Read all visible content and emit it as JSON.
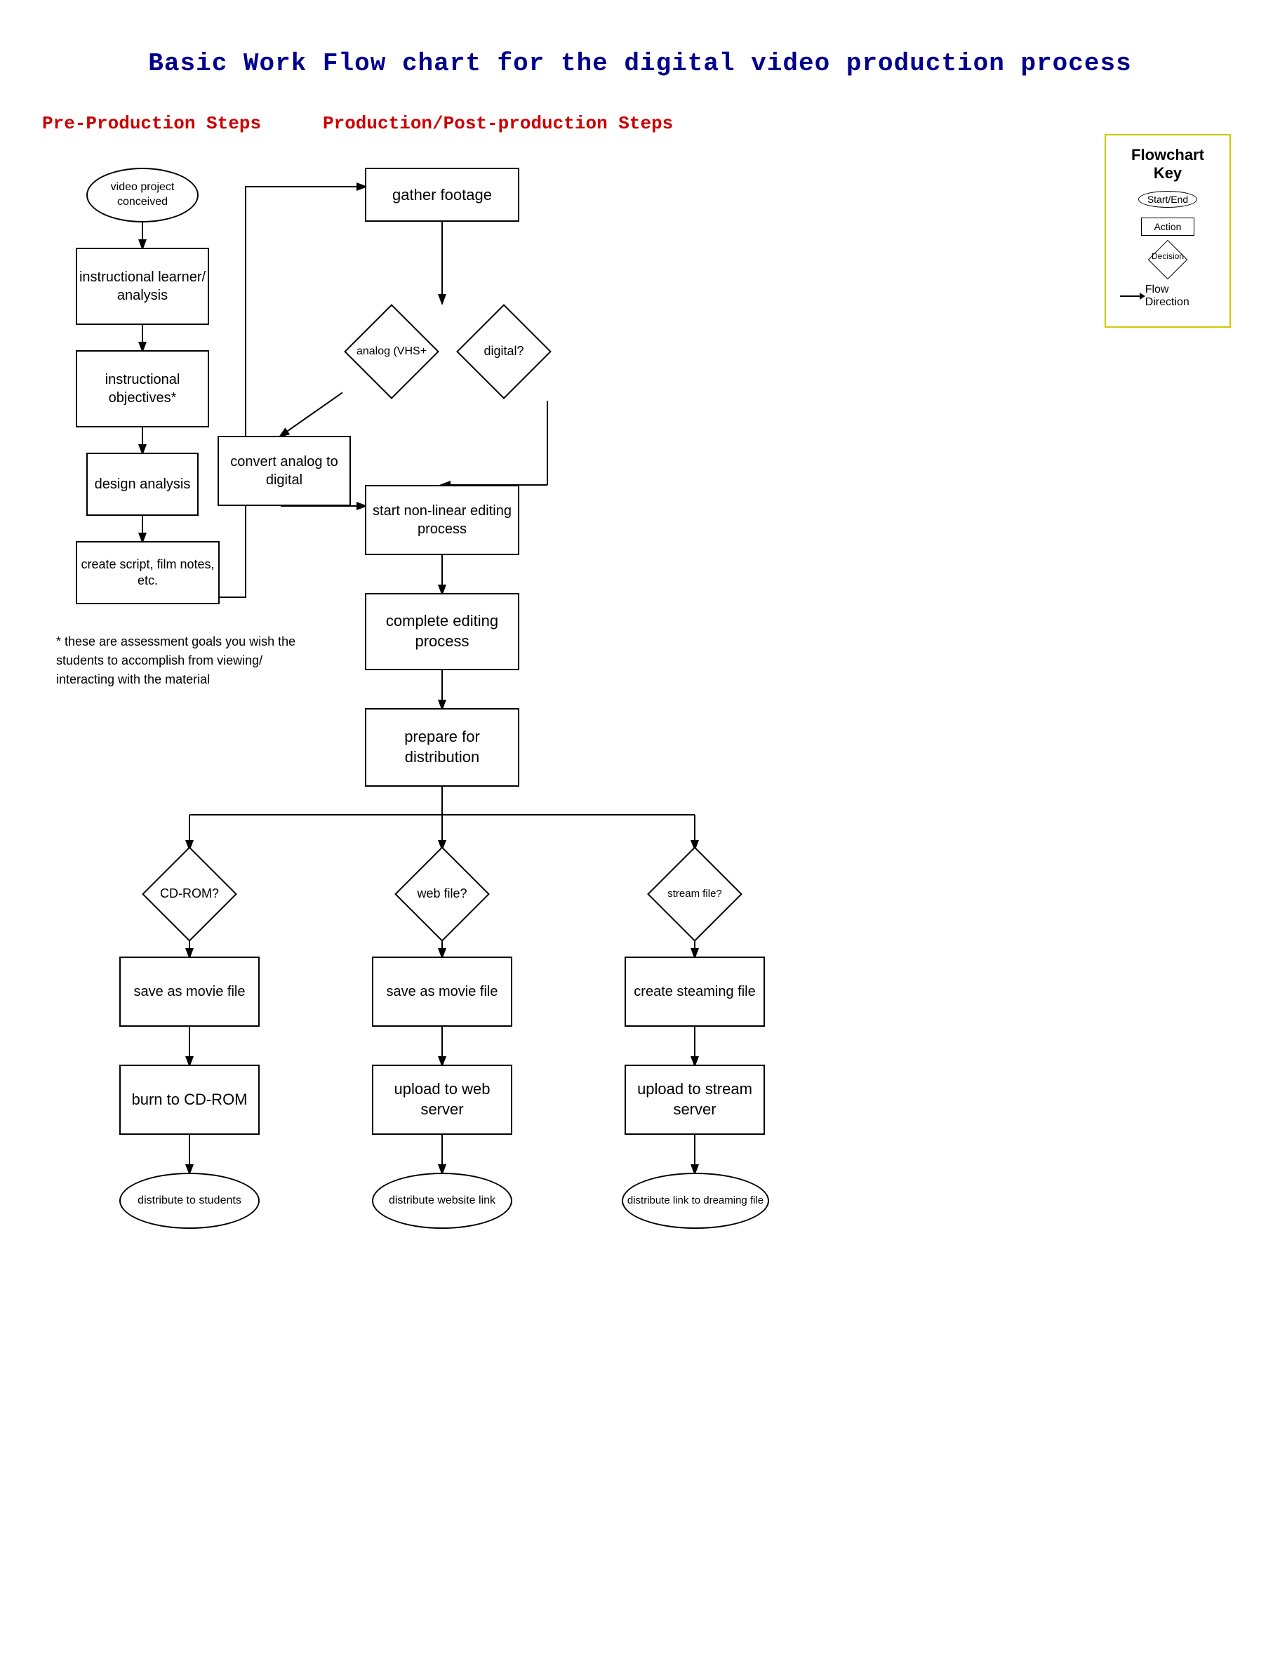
{
  "title": "Basic Work Flow chart for the digital video production process",
  "pre_production_label": "Pre-Production Steps",
  "production_label": "Production/Post-production Steps",
  "key": {
    "title": "Flowchart Key",
    "start_end_label": "Start/End",
    "action_label": "Action",
    "decision_label": "Decision",
    "flow_label": "Flow Direction"
  },
  "nodes": {
    "video_project_conceived": "video project\nconceived",
    "instructional_learner": "instructional\nlearner/ analysis",
    "instructional_objectives": "instructional\nobjectives*",
    "design_analysis": "design\nanalysis",
    "create_script": "create script,\nfilm notes, etc.",
    "gather_footage": "gather footage",
    "analog_vhs": "analog (VHS+",
    "digital": "digital?",
    "convert_analog": "convert analog\nto digital",
    "start_nonlinear": "start non-linear\nediting process",
    "complete_editing": "complete\nediting process",
    "prepare_distribution": "prepare for\ndistribution",
    "cdrom_decision": "CD-ROM?",
    "web_decision": "web file?",
    "stream_decision": "stream\nfile?",
    "save_movie_cdrom": "save as movie\nfile",
    "save_movie_web": "save as movie\nfile",
    "create_streaming": "create\nsteaming file",
    "burn_cdrom": "burn to\nCD-ROM",
    "upload_web": "upload to\nweb server",
    "upload_stream": "upload to\nstream server",
    "distribute_students": "distribute to students",
    "distribute_website": "distribute website link",
    "distribute_streaming": "distribute link to\ndreaming file"
  },
  "note": "* these are assessment goals you wish the students to accomplish from viewing/ interacting with the material"
}
